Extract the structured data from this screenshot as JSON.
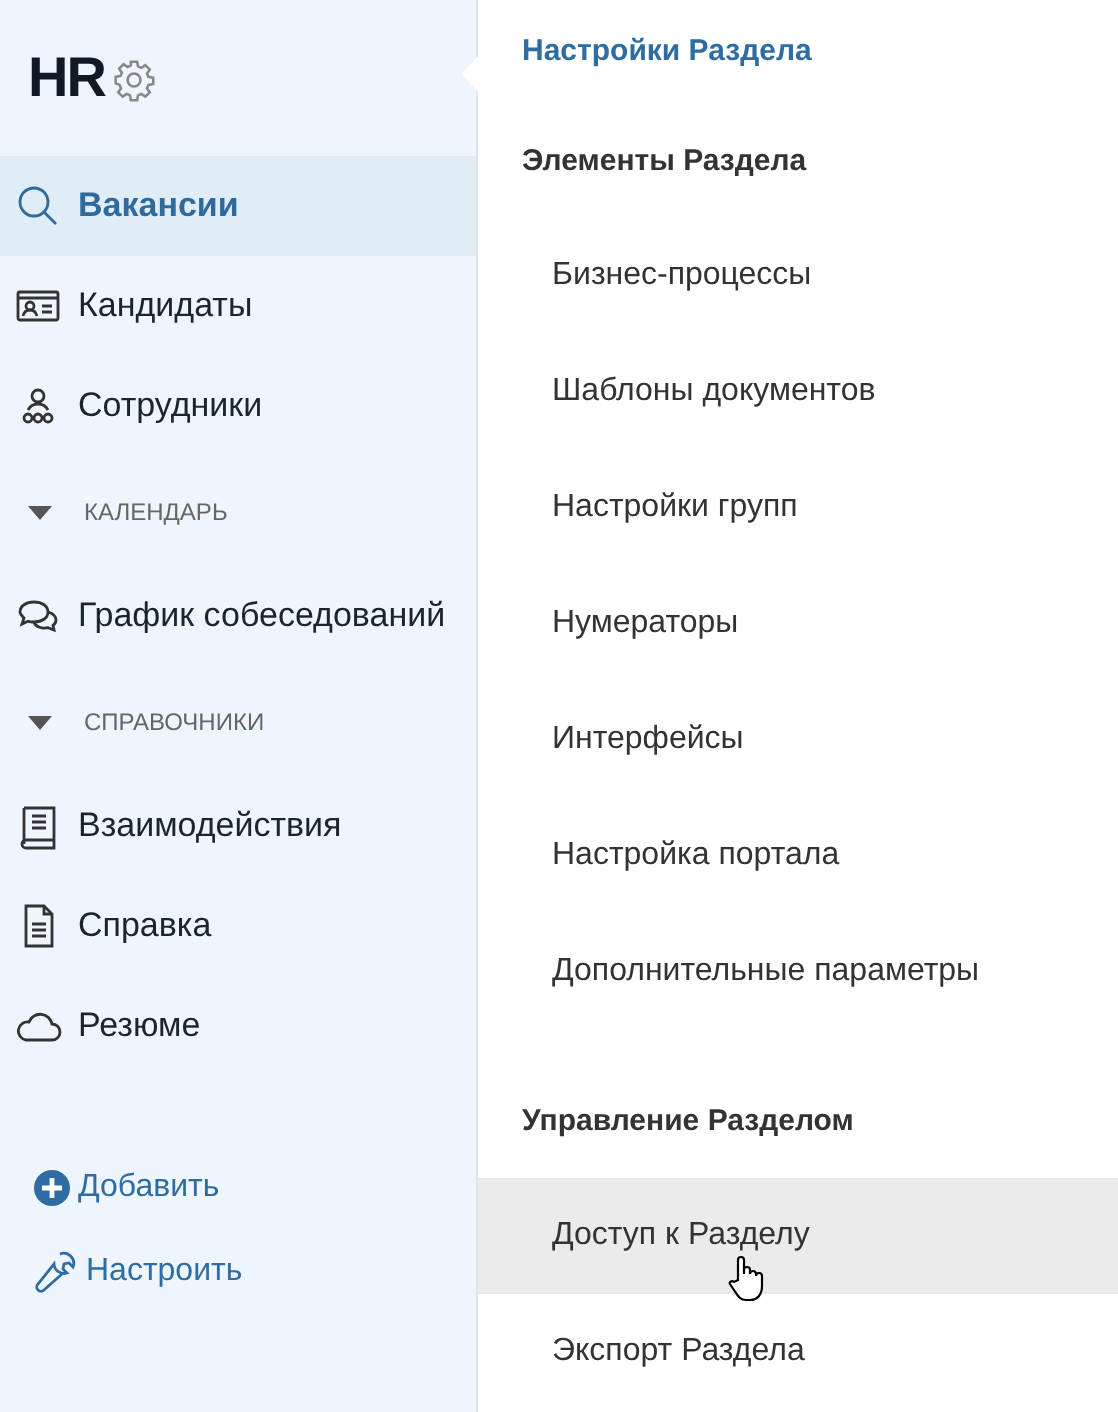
{
  "sidebar": {
    "title": "HR",
    "items": [
      {
        "kind": "nav",
        "label": "Вакансии",
        "selected": true
      },
      {
        "kind": "nav",
        "label": "Кандидаты",
        "selected": false
      },
      {
        "kind": "nav",
        "label": "Сотрудники",
        "selected": false
      },
      {
        "kind": "section",
        "label": "КАЛЕНДАРЬ",
        "expanded": true
      },
      {
        "kind": "nav",
        "label": "График собеседований",
        "selected": false
      },
      {
        "kind": "section",
        "label": "СПРАВОЧНИКИ",
        "expanded": true
      },
      {
        "kind": "nav",
        "label": "Взаимодействия",
        "selected": false
      },
      {
        "kind": "nav",
        "label": "Справка",
        "selected": false
      },
      {
        "kind": "nav",
        "label": "Резюме",
        "selected": false
      }
    ],
    "actions": [
      "Добавить",
      "Настроить"
    ]
  },
  "settings": {
    "title": "Настройки Раздела",
    "groups": [
      {
        "heading": "Элементы Раздела",
        "items": [
          {
            "label": "Бизнес-процессы",
            "highlighted": false
          },
          {
            "label": "Шаблоны документов",
            "highlighted": false
          },
          {
            "label": "Настройки групп",
            "highlighted": false
          },
          {
            "label": "Нумераторы",
            "highlighted": false
          },
          {
            "label": "Интерфейсы",
            "highlighted": false
          },
          {
            "label": "Настройка портала",
            "highlighted": false
          },
          {
            "label": "Дополнительные параметры",
            "highlighted": false
          }
        ]
      },
      {
        "heading": "Управление Разделом",
        "items": [
          {
            "label": "Доступ к Разделу",
            "highlighted": true
          },
          {
            "label": "Экспорт Раздела",
            "highlighted": false
          }
        ]
      }
    ]
  }
}
